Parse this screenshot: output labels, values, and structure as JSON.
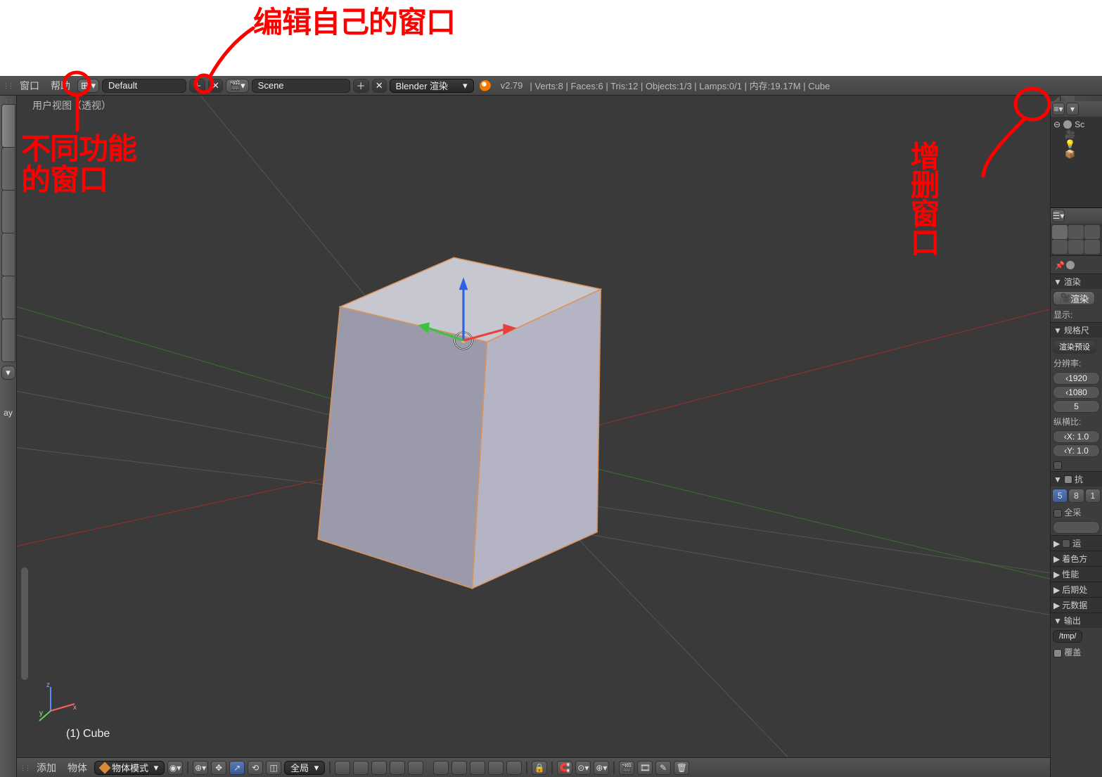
{
  "menu": {
    "window": "窗口",
    "help": "帮助"
  },
  "layout_field": "Default",
  "scene_field": "Scene",
  "render_engine": "Blender 渲染",
  "version": "v2.79",
  "stats": "Verts:8 | Faces:6 | Tris:12 | Objects:1/3 | Lamps:0/1 | 内存:19.17M | Cube",
  "viewport": {
    "view_label": "用户视图（透视）",
    "object_label": "(1) Cube"
  },
  "vp_footer": {
    "add": "添加",
    "object": "物体",
    "mode": "物体模式",
    "global": "全局"
  },
  "outliner": {
    "search_placeholder": "",
    "scene_item": "Sc"
  },
  "props": {
    "render_section": "渲染",
    "render_btn": "渲染",
    "display": "显示:",
    "dimension_section": "规格尺",
    "render_preset": "渲染预设",
    "resolution": "分辨率:",
    "res_x": "1920",
    "res_y": "1080",
    "res_pct": "5",
    "aspect": "纵横比:",
    "aspect_x": "X: 1.0",
    "aspect_y": "Y: 1.0",
    "aa_section": "抗",
    "aa_5": "5",
    "aa_8": "8",
    "aa_1": "1",
    "full_sample": "全采",
    "shading": "着色方",
    "performance": "性能",
    "post": "后期处",
    "metadata": "元数据",
    "output": "输出",
    "output_path": "/tmp/",
    "overwrite": "覆盖",
    "run_label": "运"
  },
  "left_sidebar_label": "ay",
  "annotations": {
    "top": "编辑自己的窗口",
    "left1": "不同功能",
    "left2": "的窗口",
    "right": "增删窗口"
  }
}
